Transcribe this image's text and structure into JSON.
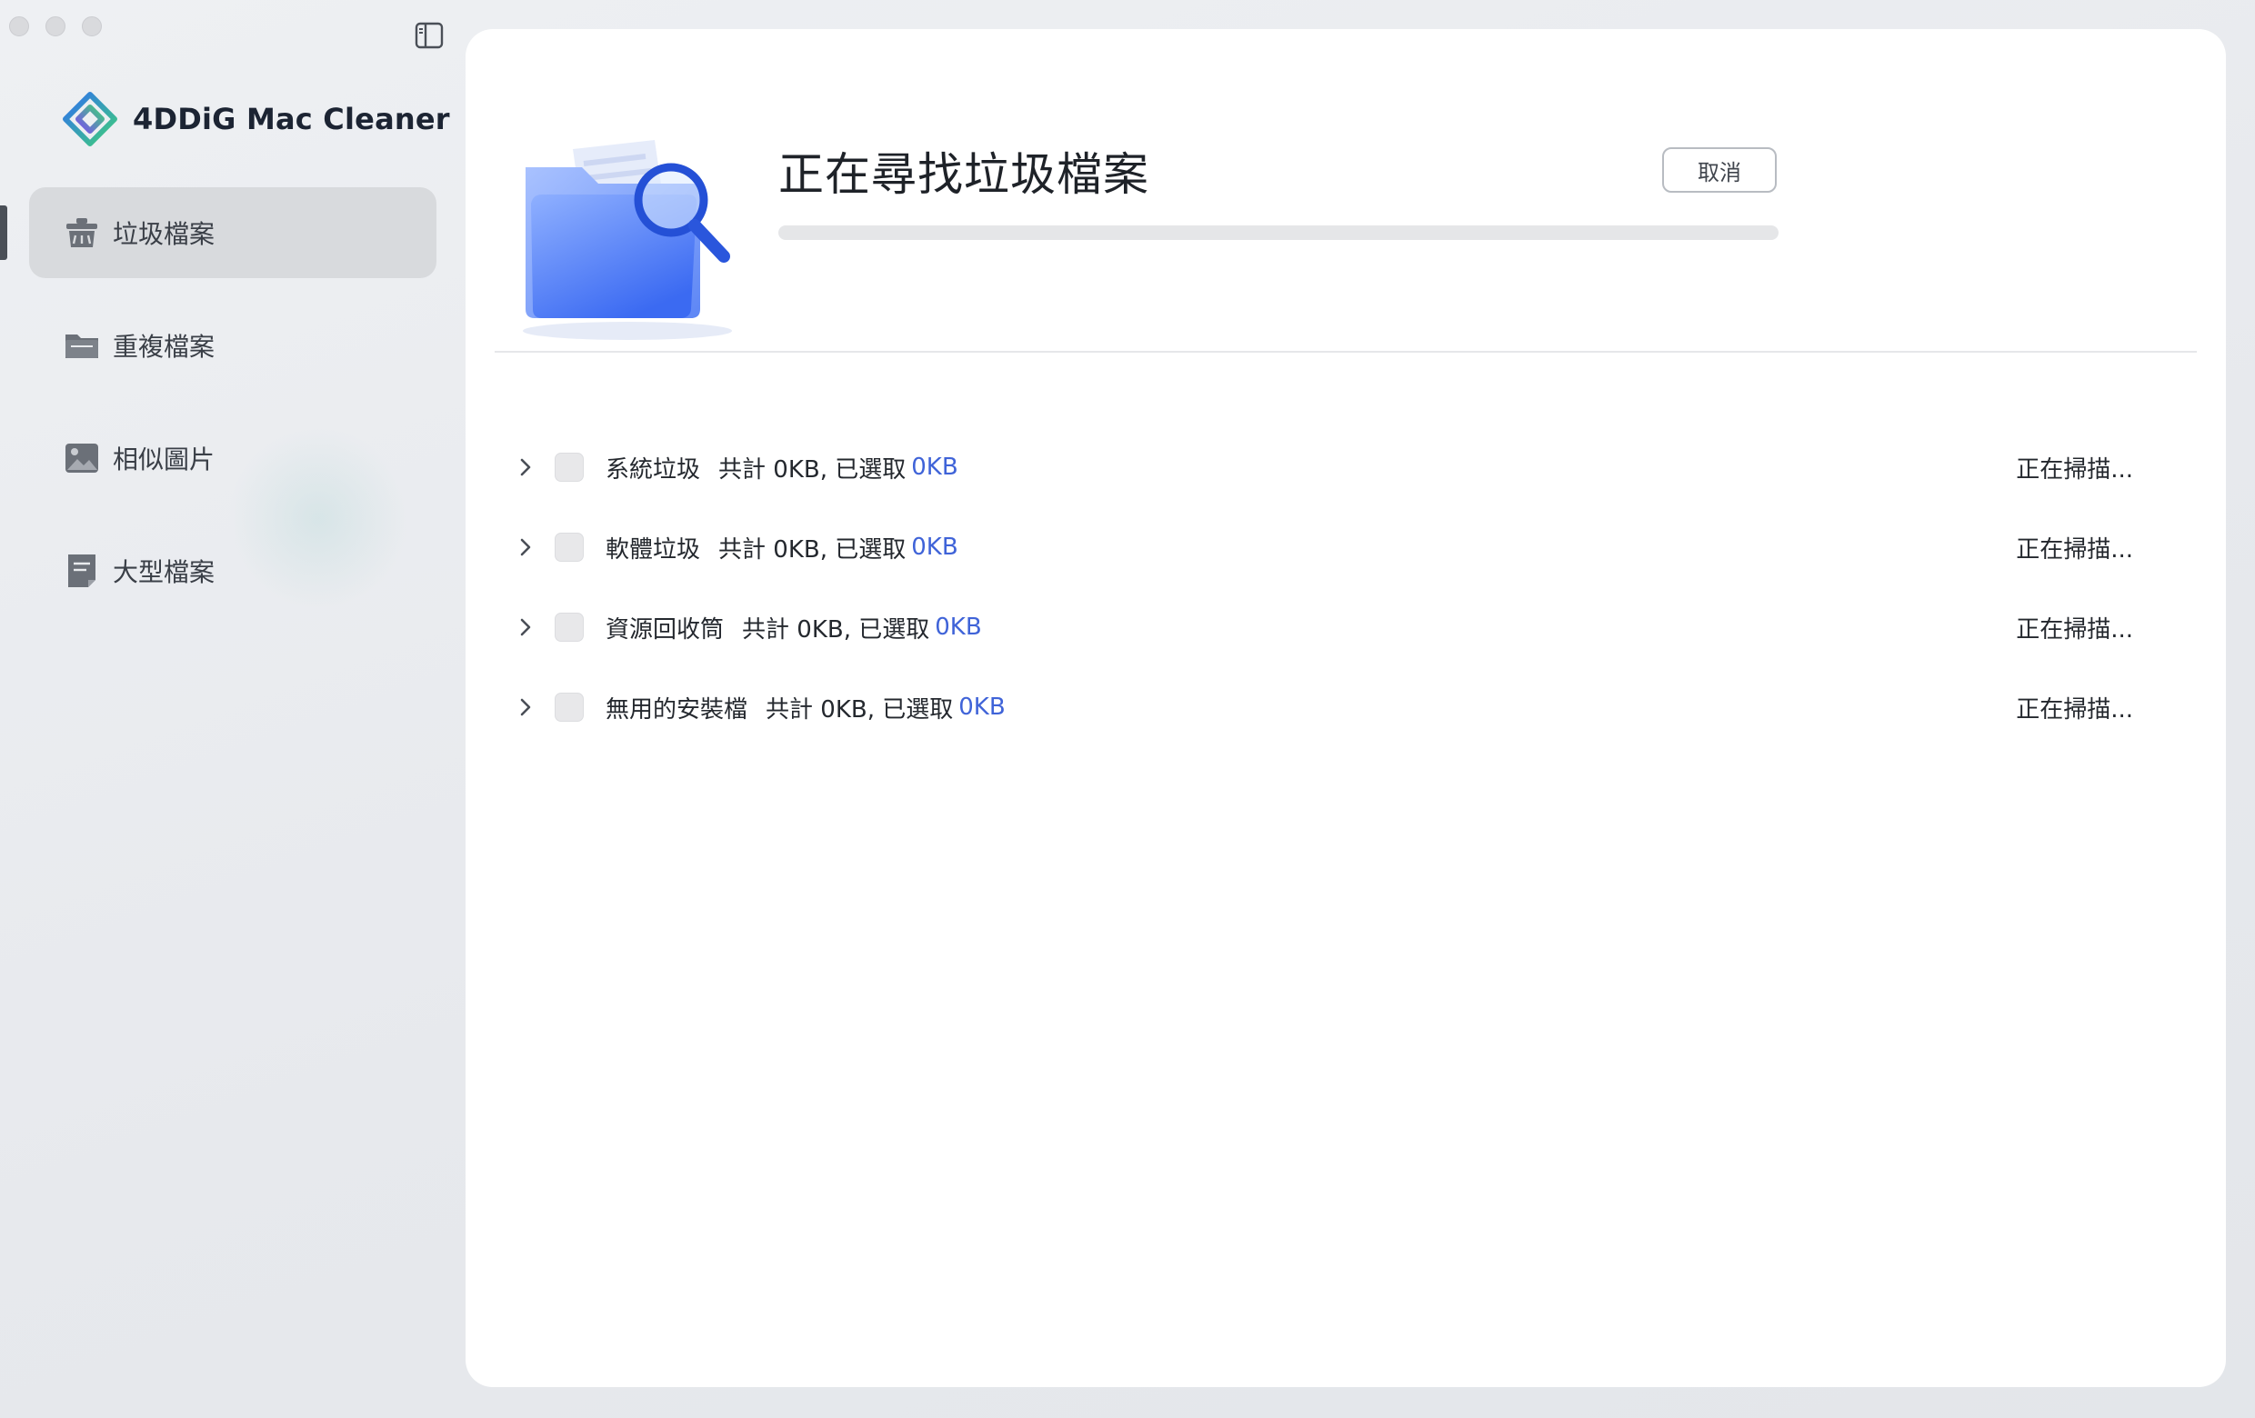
{
  "app": {
    "name": "4DDiG Mac Cleaner"
  },
  "sidebar": {
    "items": [
      {
        "label": "垃圾檔案",
        "icon": "trash-bin-icon",
        "active": true
      },
      {
        "label": "重複檔案",
        "icon": "folder-icon",
        "active": false
      },
      {
        "label": "相似圖片",
        "icon": "image-icon",
        "active": false
      },
      {
        "label": "大型檔案",
        "icon": "large-file-icon",
        "active": false
      }
    ]
  },
  "scan": {
    "title": "正在尋找垃圾檔案",
    "cancel_label": "取消",
    "progress": 0
  },
  "categories": [
    {
      "name": "系統垃圾",
      "total": "共計 0KB, 已選取",
      "selected": "0KB",
      "status": "正在掃描..."
    },
    {
      "name": "軟體垃圾",
      "total": "共計 0KB, 已選取",
      "selected": "0KB",
      "status": "正在掃描..."
    },
    {
      "name": "資源回收筒",
      "total": "共計 0KB, 已選取",
      "selected": "0KB",
      "status": "正在掃描..."
    },
    {
      "name": "無用的安裝檔",
      "total": "共計 0KB, 已選取",
      "selected": "0KB",
      "status": "正在掃描..."
    }
  ],
  "colors": {
    "accent": "#3f63d8",
    "sidebar_active": "#d8dadd"
  }
}
